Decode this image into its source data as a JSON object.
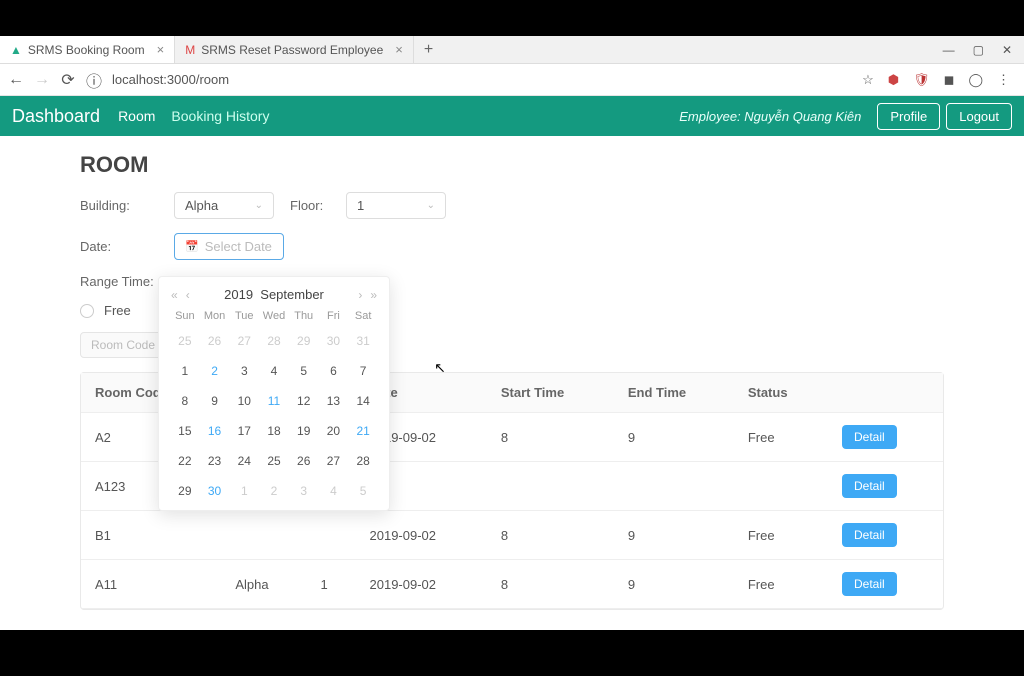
{
  "browser": {
    "tabs": [
      {
        "title": "SRMS Booking Room",
        "active": true
      },
      {
        "title": "SRMS Reset Password Employee",
        "active": false
      }
    ],
    "url": "localhost:3000/room"
  },
  "navbar": {
    "brand": "Dashboard",
    "links": [
      {
        "label": "Room",
        "active": true
      },
      {
        "label": "Booking History",
        "active": false
      }
    ],
    "employee_prefix": "Employee: ",
    "employee_name": "Nguyễn Quang Kiên",
    "profile": "Profile",
    "logout": "Logout"
  },
  "page": {
    "title": "ROOM",
    "building_label": "Building:",
    "building_value": "Alpha",
    "floor_label": "Floor:",
    "floor_value": "1",
    "date_label": "Date:",
    "date_placeholder": "Select Date",
    "range_label": "Range Time:",
    "free_label": "Free",
    "roomcode_btn": "Room Code"
  },
  "calendar": {
    "year": "2019",
    "month": "September",
    "dow": [
      "Sun",
      "Mon",
      "Tue",
      "Wed",
      "Thu",
      "Fri",
      "Sat"
    ],
    "weeks": [
      [
        {
          "d": "25",
          "m": true
        },
        {
          "d": "26",
          "m": true
        },
        {
          "d": "27",
          "m": true
        },
        {
          "d": "28",
          "m": true
        },
        {
          "d": "29",
          "m": true
        },
        {
          "d": "30",
          "m": true
        },
        {
          "d": "31",
          "m": true
        }
      ],
      [
        {
          "d": "1"
        },
        {
          "d": "2",
          "l": true
        },
        {
          "d": "3"
        },
        {
          "d": "4"
        },
        {
          "d": "5"
        },
        {
          "d": "6"
        },
        {
          "d": "7"
        }
      ],
      [
        {
          "d": "8"
        },
        {
          "d": "9"
        },
        {
          "d": "10"
        },
        {
          "d": "11",
          "l": true
        },
        {
          "d": "12"
        },
        {
          "d": "13"
        },
        {
          "d": "14"
        }
      ],
      [
        {
          "d": "15"
        },
        {
          "d": "16",
          "l": true
        },
        {
          "d": "17"
        },
        {
          "d": "18"
        },
        {
          "d": "19"
        },
        {
          "d": "20"
        },
        {
          "d": "21",
          "l": true
        }
      ],
      [
        {
          "d": "22"
        },
        {
          "d": "23"
        },
        {
          "d": "24"
        },
        {
          "d": "25"
        },
        {
          "d": "26"
        },
        {
          "d": "27"
        },
        {
          "d": "28"
        }
      ],
      [
        {
          "d": "29"
        },
        {
          "d": "30",
          "l": true
        },
        {
          "d": "1",
          "m": true
        },
        {
          "d": "2",
          "m": true
        },
        {
          "d": "3",
          "m": true
        },
        {
          "d": "4",
          "m": true
        },
        {
          "d": "5",
          "m": true
        }
      ]
    ]
  },
  "table": {
    "headers": [
      "Room Code",
      "",
      "",
      "Date",
      "Start Time",
      "End Time",
      "Status",
      ""
    ],
    "detail_label": "Detail",
    "rows": [
      {
        "code": "A2",
        "building": "",
        "floor": "",
        "date": "2019-09-02",
        "start": "8",
        "end": "9",
        "status": "Free"
      },
      {
        "code": "A123",
        "building": "",
        "floor": "",
        "date": "",
        "start": "",
        "end": "",
        "status": ""
      },
      {
        "code": "B1",
        "building": "",
        "floor": "",
        "date": "2019-09-02",
        "start": "8",
        "end": "9",
        "status": "Free"
      },
      {
        "code": "A11",
        "building": "Alpha",
        "floor": "1",
        "date": "2019-09-02",
        "start": "8",
        "end": "9",
        "status": "Free"
      }
    ]
  }
}
